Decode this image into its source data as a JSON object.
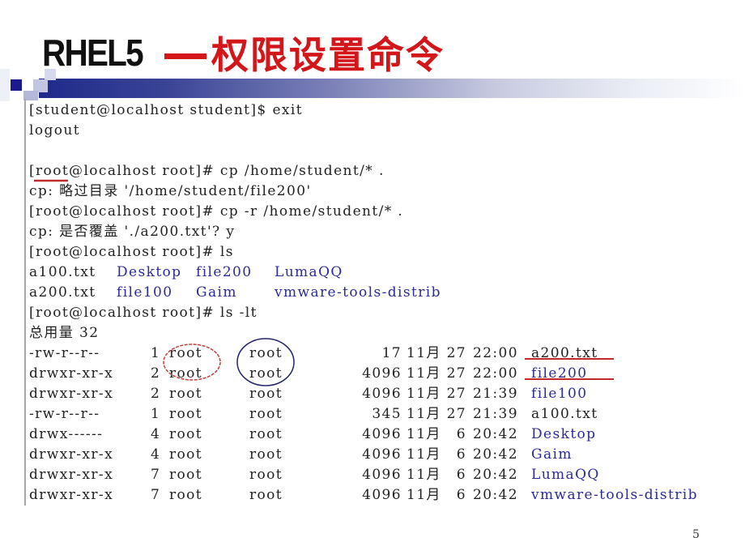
{
  "slide": {
    "title_en": "RHEL5",
    "title_cn": "权限设置命令",
    "page_number": "5",
    "accent_color": "#d2161a",
    "link_color": "#2a2a9a"
  },
  "terminal": {
    "lines": [
      {
        "text": "[student@localhost student]$ exit"
      },
      {
        "text": "logout"
      },
      {
        "text": ""
      },
      {
        "text": "[root@localhost root]# cp /home/student/* ."
      },
      {
        "text": "cp: 略过目录 '/home/student/file200'"
      },
      {
        "text": "[root@localhost root]# cp -r /home/student/* ."
      },
      {
        "text": "cp: 是否覆盖 './a200.txt'? y"
      },
      {
        "text": "[root@localhost root]# ls"
      }
    ],
    "ls_output": [
      [
        {
          "name": "a100.txt",
          "type": "file"
        },
        {
          "name": "Desktop",
          "type": "dir"
        },
        {
          "name": "file200",
          "type": "dir"
        },
        {
          "name": "LumaQQ",
          "type": "dir"
        }
      ],
      [
        {
          "name": "a200.txt",
          "type": "file"
        },
        {
          "name": "file100",
          "type": "dir"
        },
        {
          "name": "Gaim",
          "type": "dir"
        },
        {
          "name": "vmware-tools-distrib",
          "type": "dir"
        }
      ]
    ],
    "ls_lt_command": "[root@localhost root]# ls -lt",
    "total_line": "总用量 32",
    "listing": [
      {
        "perm": "-rw-r--r--",
        "links": "1",
        "owner": "root",
        "group": "root",
        "size": "17",
        "month": "11月",
        "day": "27",
        "time": "22:00",
        "name": "a200.txt",
        "type": "file"
      },
      {
        "perm": "drwxr-xr-x",
        "links": "2",
        "owner": "root",
        "group": "root",
        "size": "4096",
        "month": "11月",
        "day": "27",
        "time": "22:00",
        "name": "file200",
        "type": "dir"
      },
      {
        "perm": "drwxr-xr-x",
        "links": "2",
        "owner": "root",
        "group": "root",
        "size": "4096",
        "month": "11月",
        "day": "27",
        "time": "21:39",
        "name": "file100",
        "type": "dir"
      },
      {
        "perm": "-rw-r--r--",
        "links": "1",
        "owner": "root",
        "group": "root",
        "size": "345",
        "month": "11月",
        "day": "27",
        "time": "21:39",
        "name": "a100.txt",
        "type": "file"
      },
      {
        "perm": "drwx------",
        "links": "4",
        "owner": "root",
        "group": "root",
        "size": "4096",
        "month": "11月",
        "day": "6",
        "time": "20:42",
        "name": "Desktop",
        "type": "dir"
      },
      {
        "perm": "drwxr-xr-x",
        "links": "4",
        "owner": "root",
        "group": "root",
        "size": "4096",
        "month": "11月",
        "day": "6",
        "time": "20:42",
        "name": "Gaim",
        "type": "dir"
      },
      {
        "perm": "drwxr-xr-x",
        "links": "7",
        "owner": "root",
        "group": "root",
        "size": "4096",
        "month": "11月",
        "day": "6",
        "time": "20:42",
        "name": "LumaQQ",
        "type": "dir"
      },
      {
        "perm": "drwxr-xr-x",
        "links": "7",
        "owner": "root",
        "group": "root",
        "size": "4096",
        "month": "11月",
        "day": "6",
        "time": "20:42",
        "name": "vmware-tools-distrib",
        "type": "dir"
      }
    ]
  },
  "annotations": {
    "underline_color": "#c0282a",
    "owner_ellipse_color": "#c0403a",
    "group_circle_color": "#22226e"
  }
}
